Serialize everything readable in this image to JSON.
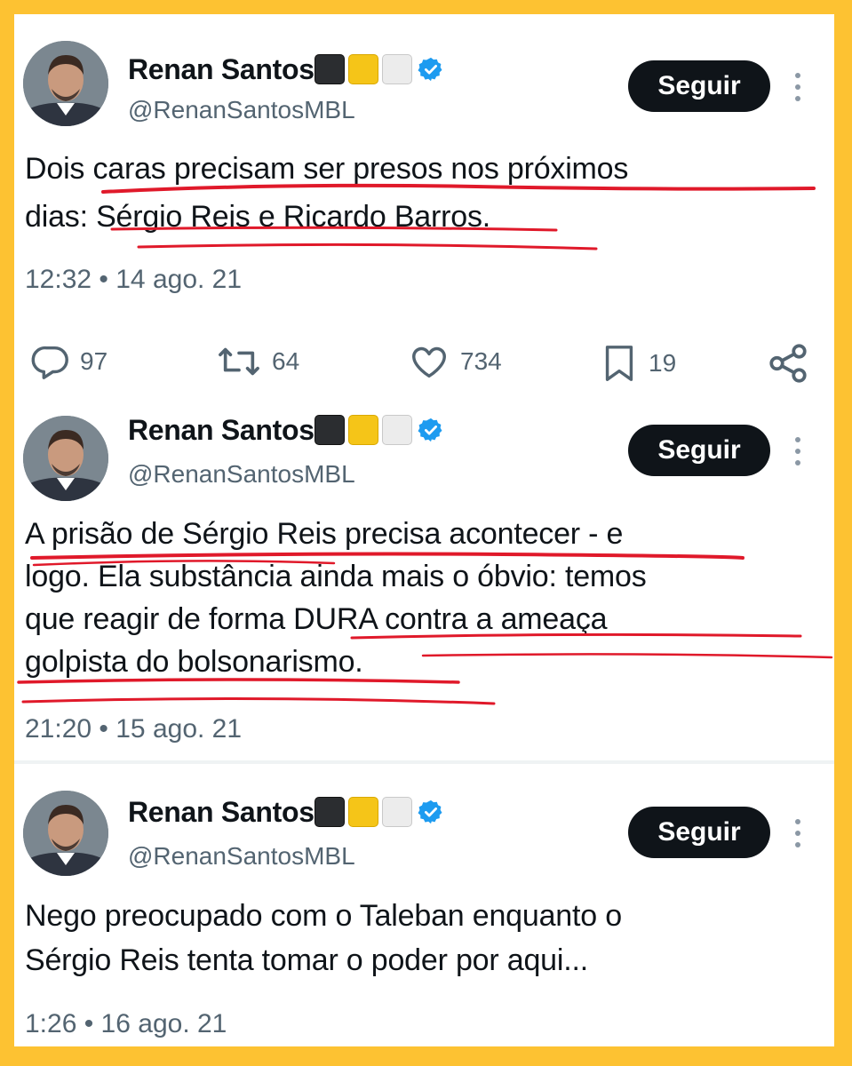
{
  "colors": {
    "frame_border": "#fdc232",
    "follow_bg": "#0f1419",
    "verified": "#1d9bf0",
    "underline": "#e0192a",
    "secondary_text": "#536471"
  },
  "tweets": [
    {
      "name": "Renan Santos",
      "flags": [
        "black-square",
        "yellow-square",
        "white-square"
      ],
      "verified_icon": "verified-badge-icon",
      "handle": "@RenanSantosMBL",
      "follow_label": "Seguir",
      "lines": [
        "Dois caras precisam ser presos nos próximos",
        "dias: Sérgio Reis e Ricardo Barros."
      ],
      "timestamp": "12:32 • 14 ago. 21",
      "actions": {
        "replies": "97",
        "retweets": "64",
        "likes": "734",
        "bookmarks": "19"
      }
    },
    {
      "name": "Renan Santos",
      "flags": [
        "black-square",
        "yellow-square",
        "white-square"
      ],
      "verified_icon": "verified-badge-icon",
      "handle": "@RenanSantosMBL",
      "follow_label": "Seguir",
      "lines": [
        "A prisão de Sérgio Reis precisa acontecer - e",
        "logo. Ela substância ainda mais o óbvio: temos",
        "que reagir de forma DURA contra a ameaça",
        "golpista do bolsonarismo."
      ],
      "timestamp": "21:20 • 15 ago. 21"
    },
    {
      "name": "Renan Santos",
      "flags": [
        "black-square",
        "yellow-square",
        "white-square"
      ],
      "verified_icon": "verified-badge-icon",
      "handle": "@RenanSantosMBL",
      "follow_label": "Seguir",
      "lines": [
        "Nego preocupado com o Taleban enquanto o",
        "Sérgio Reis tenta tomar o poder por aqui..."
      ],
      "timestamp": "1:26 • 16 ago. 21"
    }
  ]
}
